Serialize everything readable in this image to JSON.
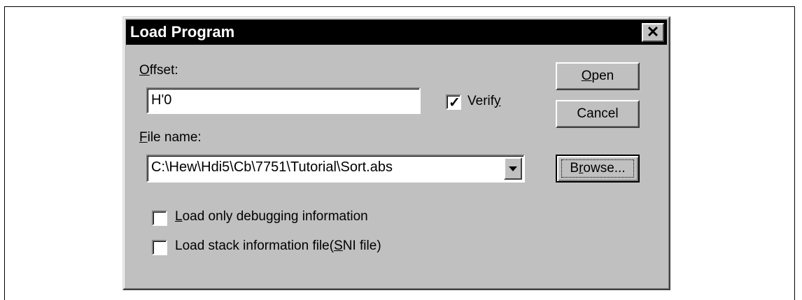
{
  "dialog": {
    "title": "Load Program",
    "close_icon": "close-icon"
  },
  "offset": {
    "label_prefix": "",
    "label_underlined": "O",
    "label_rest": "ffset:",
    "value": "H'0"
  },
  "verify": {
    "checked": true,
    "label_before": "Verif",
    "label_underlined": "y",
    "label_after": ""
  },
  "file_name": {
    "label_underlined": "F",
    "label_rest": "ile name:",
    "value": "C:\\Hew\\Hdi5\\Cb\\7751\\Tutorial\\Sort.abs"
  },
  "options": {
    "debug_only": {
      "checked": false,
      "label_underlined": "L",
      "label_rest": "oad only debugging information"
    },
    "stack_info": {
      "checked": false,
      "label_before": "Load stack information file(",
      "label_underlined": "S",
      "label_rest": "NI file)"
    }
  },
  "buttons": {
    "open_underlined": "O",
    "open_rest": "pen",
    "cancel": "Cancel",
    "browse_before": "B",
    "browse_underlined": "r",
    "browse_rest": "owse..."
  }
}
